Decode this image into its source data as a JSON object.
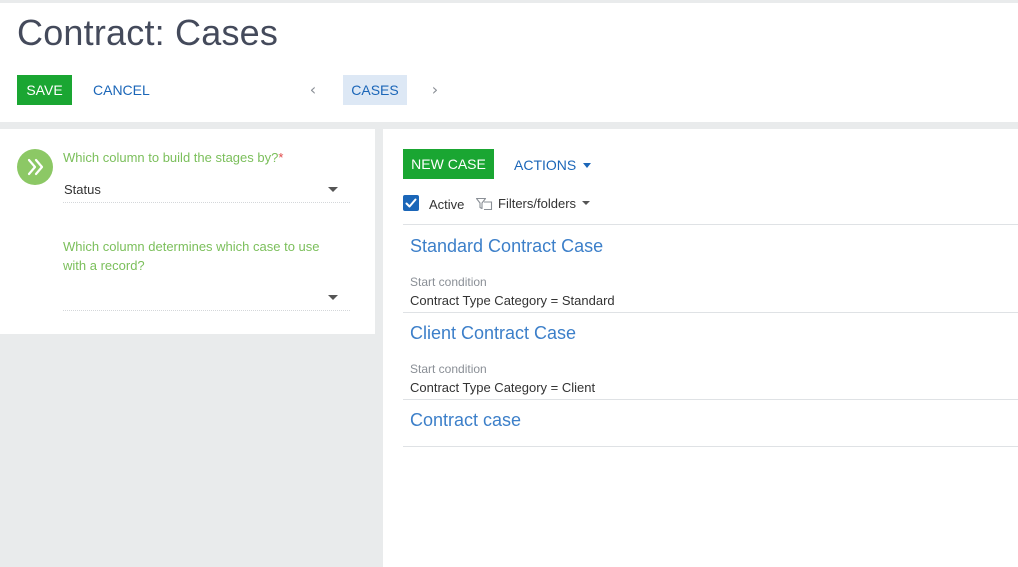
{
  "header": {
    "title": "Contract: Cases",
    "save_label": "SAVE",
    "cancel_label": "CANCEL",
    "prev_glyph": "‹",
    "next_glyph": "›",
    "tab_label": "CASES"
  },
  "settings": {
    "stage_column": {
      "label": "Which column to build the stages by?",
      "required_mark": "*",
      "value": "Status"
    },
    "case_column": {
      "label_line1": "Which column determines which case to use",
      "label_line2": "with a record?",
      "value": ""
    }
  },
  "cases_panel": {
    "new_case_label": "NEW CASE",
    "actions_label": "ACTIONS",
    "active_label": "Active",
    "active_checked": true,
    "filters_label": "Filters/folders",
    "items": [
      {
        "title": "Standard Contract Case",
        "condition_label": "Start condition",
        "condition_value": "Contract Type Category = Standard"
      },
      {
        "title": "Client Contract Case",
        "condition_label": "Start condition",
        "condition_value": "Contract Type Category = Client"
      },
      {
        "title": "Contract case"
      }
    ]
  },
  "colors": {
    "primary_green": "#1aa632",
    "link_blue": "#1b66b8",
    "label_green": "#7bbf5b",
    "tab_bg": "#dde8f5"
  }
}
